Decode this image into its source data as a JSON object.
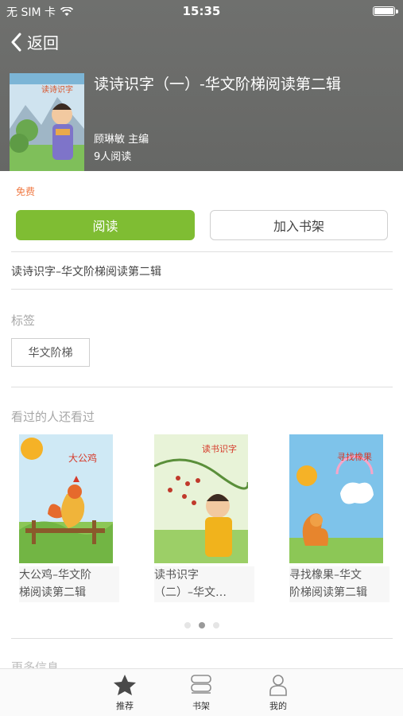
{
  "status_bar": {
    "carrier": "无 SIM 卡",
    "time": "15:35"
  },
  "nav": {
    "back_label": "返回"
  },
  "book": {
    "title": "读诗识字（一）-华文阶梯阅读第二辑",
    "author": "顾琳敏  主编",
    "readers": "9人阅读",
    "price": "免费",
    "description": "读诗识字–华文阶梯阅读第二辑",
    "cover_text": "读诗识字"
  },
  "actions": {
    "read_label": "阅读",
    "shelf_label": "加入书架"
  },
  "tags_section": {
    "label": "标签",
    "tags": [
      "华文阶梯"
    ]
  },
  "related": {
    "label": "看过的人还看过",
    "books": [
      {
        "line1": "大公鸡–华文阶",
        "line2": "梯阅读第二辑",
        "cover_text": "大公鸡"
      },
      {
        "line1": "读书识字",
        "line2": "（二）–华文…",
        "cover_text": "读书识字"
      },
      {
        "line1": "寻找橡果–华文",
        "line2": "阶梯阅读第二辑",
        "cover_text": "寻找橡果"
      }
    ],
    "pagination": {
      "count": 3,
      "active": 2
    }
  },
  "more_info_label": "更多信息",
  "tabbar": {
    "items": [
      "推荐",
      "书架",
      "我的"
    ],
    "active": "推荐"
  },
  "colors": {
    "accent": "#7fbd33",
    "price": "#f07a44",
    "header_bg": "#6b6c6a"
  }
}
